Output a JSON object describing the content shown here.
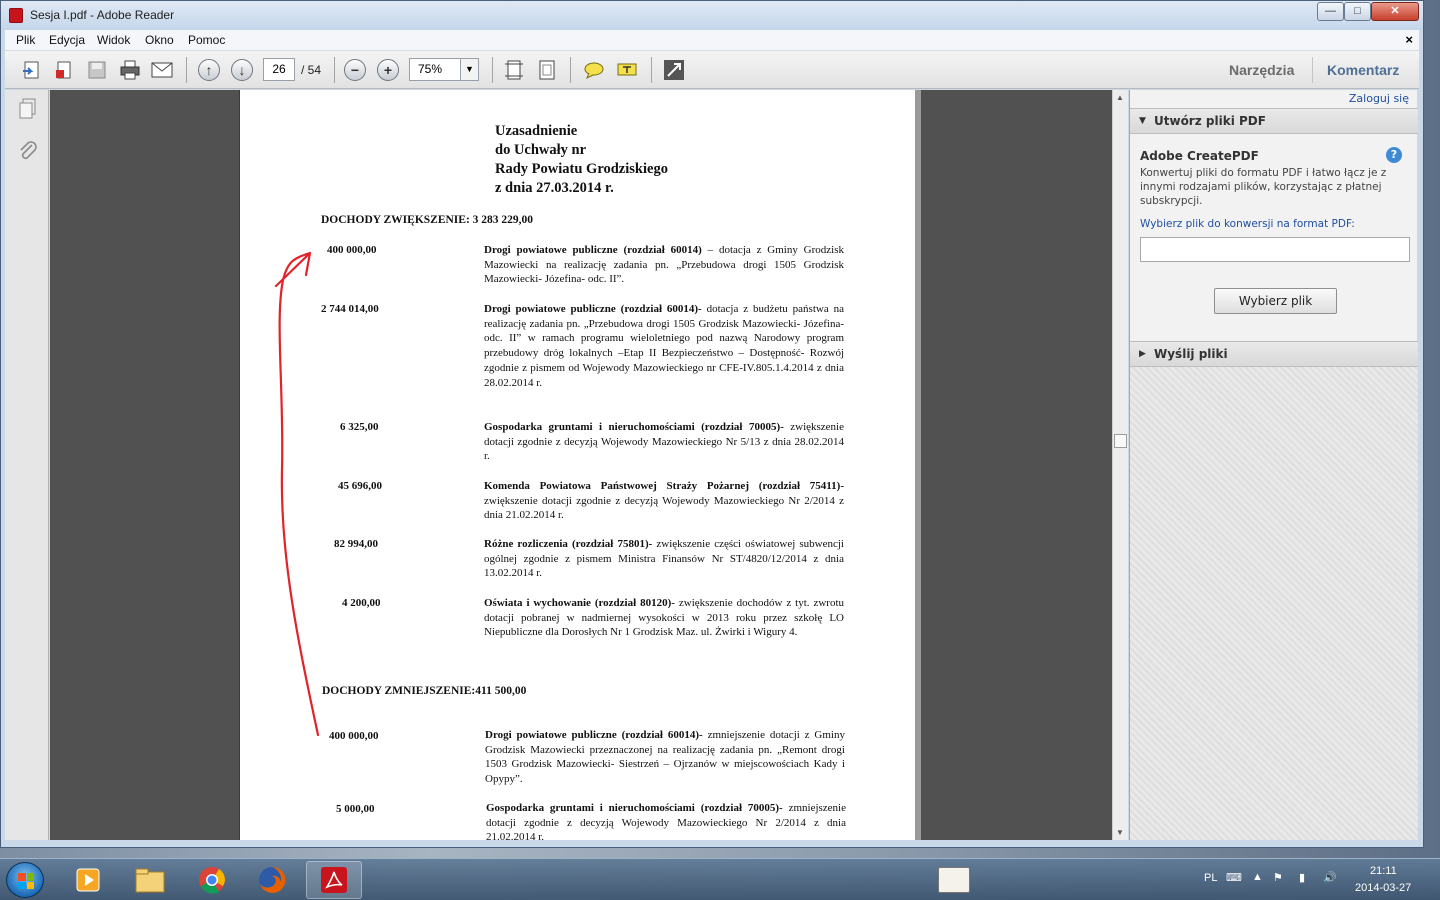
{
  "window": {
    "title": "Sesja I.pdf - Adobe Reader",
    "minimize": "—",
    "maximize": "□",
    "close": "✕"
  },
  "menu": {
    "items": [
      "Plik",
      "Edycja",
      "Widok",
      "Okno",
      "Pomoc"
    ],
    "close_doc": "×"
  },
  "toolbar": {
    "page_current": "26",
    "page_total": "/ 54",
    "zoom": "75%",
    "tools_label": "Narzędzia",
    "comment_label": "Komentarz",
    "icons": [
      "open-icon",
      "create-icon",
      "save-icon",
      "print-icon",
      "email-icon",
      "prev-page-icon",
      "next-page-icon",
      "zoom-out-icon",
      "zoom-in-icon",
      "fit-width-icon",
      "fit-page-icon",
      "comment-icon",
      "highlight-icon",
      "fullscreen-icon"
    ]
  },
  "document": {
    "heading": [
      "Uzasadnienie",
      "do Uchwały nr",
      "Rady Powiatu Grodziskiego",
      "z dnia 27.03.2014 r."
    ],
    "increase_title": "DOCHODY ZWIĘKSZENIE: 3 283 229,00",
    "increase_items": [
      {
        "amount": "400 000,00",
        "bold": "Drogi powiatowe publiczne (rozdział 60014)",
        "text": " – dotacja z Gminy Grodzisk Mazowiecki na realizację zadania pn. „Przebudowa drogi 1505 Grodzisk Mazowiecki- Józefina- odc. II”."
      },
      {
        "amount": "2 744 014,00",
        "bold": "Drogi powiatowe publiczne (rozdział 60014)-",
        "text": " dotacja z budżetu państwa na realizację zadania pn. „Przebudowa drogi 1505 Grodzisk Mazowiecki- Józefina- odc. II” w ramach programu wieloletniego pod nazwą Narodowy program przebudowy dróg lokalnych –Etap II Bezpieczeństwo – Dostępność- Rozwój zgodnie z pismem od Wojewody Mazowieckiego nr CFE-IV.805.1.4.2014 z dnia 28.02.2014 r."
      },
      {
        "amount": "6 325,00",
        "bold": "Gospodarka gruntami i nieruchomościami (rozdział 70005)-",
        "text": " zwiększenie dotacji zgodnie z decyzją Wojewody Mazowieckiego Nr 5/13 z dnia 28.02.2014 r."
      },
      {
        "amount": "45 696,00",
        "bold": "Komenda Powiatowa Państwowej Straży Pożarnej (rozdział 75411)-",
        "text": " zwiększenie dotacji zgodnie z decyzją Wojewody Mazowieckiego Nr 2/2014 z dnia 21.02.2014 r."
      },
      {
        "amount": "82 994,00",
        "bold": "Różne rozliczenia (rozdział 75801)-",
        "text": " zwiększenie części oświatowej subwencji ogólnej zgodnie z pismem Ministra Finansów Nr ST/4820/12/2014 z dnia 13.02.2014 r."
      },
      {
        "amount": "4 200,00",
        "bold": "Oświata i wychowanie (rozdział 80120)-",
        "text": " zwiększenie dochodów z tyt. zwrotu dotacji pobranej w nadmiernej wysokości w 2013 roku przez szkołę LO Niepubliczne dla Dorosłych Nr 1 Grodzisk Maz. ul. Żwirki i Wigury 4."
      }
    ],
    "decrease_title": "DOCHODY ZMNIEJSZENIE:411 500,00",
    "decrease_items": [
      {
        "amount": "400 000,00",
        "bold": "Drogi powiatowe publiczne (rozdział 60014)-",
        "text": " zmniejszenie dotacji z Gminy Grodzisk Mazowiecki przeznaczonej na realizację zadania pn. „Remont drogi 1503 Grodzisk Mazowiecki- Siestrzeń – Ojrzanów w miejscowościach Kady i Opypy”."
      },
      {
        "amount": "5 000,00",
        "bold": "Gospodarka gruntami i nieruchomościami (rozdział 70005)-",
        "text": " zmniejszenie dotacji zgodnie z decyzją Wojewody Mazowieckiego Nr 2/2014 z dnia 21.02.2014 r."
      }
    ],
    "annotation_color": "#e0242a"
  },
  "panel": {
    "login": "Zaloguj się",
    "create_section": "Utwórz pliki PDF",
    "createpdf_title": "Adobe CreatePDF",
    "createpdf_desc": "Konwertuj pliki do formatu PDF i łatwo łącz je z innymi rodzajami plików, korzystając z płatnej subskrypcji.",
    "choose_label": "Wybierz plik do konwersji na format PDF:",
    "choose_button": "Wybierz plik",
    "send_section": "Wyślij pliki"
  },
  "taskbar": {
    "lang": "PL",
    "time": "21:11",
    "date": "2014-03-27",
    "apps": [
      "media-player-icon",
      "explorer-icon",
      "chrome-icon",
      "firefox-icon",
      "adobe-reader-icon"
    ]
  }
}
